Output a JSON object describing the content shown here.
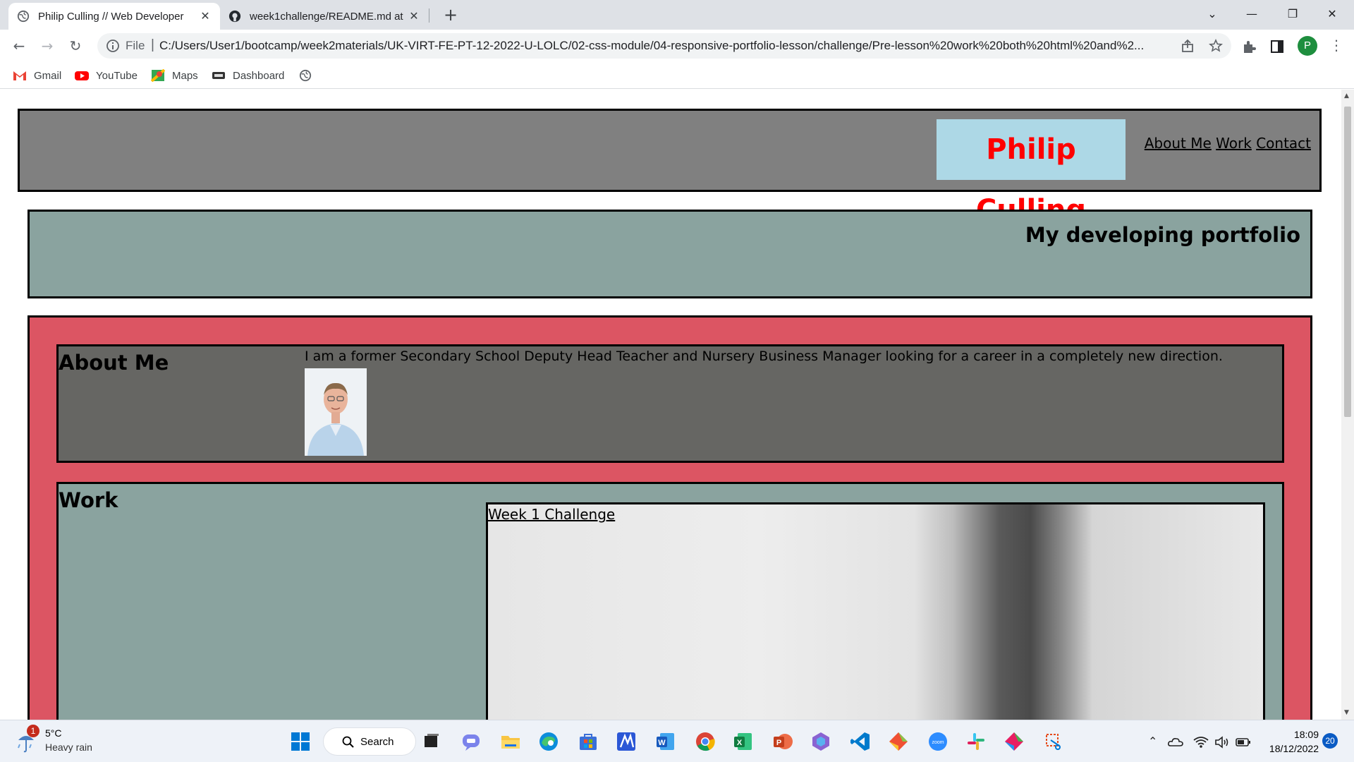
{
  "browser": {
    "tabs": [
      {
        "title": "Philip Culling // Web Developer",
        "active": true
      },
      {
        "title": "week1challenge/README.md at",
        "active": false
      }
    ],
    "omnibox": {
      "scheme_label": "File",
      "url": "C:/Users/User1/bootcamp/week2materials/UK-VIRT-FE-PT-12-2022-U-LOLC/02-css-module/04-responsive-portfolio-lesson/challenge/Pre-lesson%20work%20both%20html%20and%2..."
    },
    "profile_initial": "P",
    "bookmarks": [
      {
        "label": "Gmail",
        "icon": "gmail-icon"
      },
      {
        "label": "YouTube",
        "icon": "youtube-icon"
      },
      {
        "label": "Maps",
        "icon": "maps-icon"
      },
      {
        "label": "Dashboard",
        "icon": "dashboard-icon"
      }
    ]
  },
  "page": {
    "header": {
      "brand": "Philip Culling",
      "nav": [
        "About Me",
        "Work",
        "Contact"
      ]
    },
    "hero": {
      "heading": "My developing portfolio"
    },
    "about": {
      "heading": "About Me",
      "text": "I am a former Secondary School Deputy Head Teacher and Nursery Business Manager looking for a career in a completely new direction."
    },
    "work": {
      "heading": "Work",
      "projects": [
        {
          "title": "Week 1 Challenge"
        }
      ]
    }
  },
  "taskbar": {
    "weather": {
      "badge": "1",
      "temp": "5°C",
      "condition": "Heavy rain"
    },
    "search_label": "Search",
    "clock": {
      "time": "18:09",
      "date": "18/12/2022"
    },
    "notifications": "20"
  },
  "colors": {
    "header_bg": "#808080",
    "brand_bg": "#add8e6",
    "brand_text": "#ff0000",
    "hero_bg": "#8aa39f",
    "main_bg": "#dc5563",
    "about_bg": "#666663",
    "work_bg": "#8aa39f"
  }
}
